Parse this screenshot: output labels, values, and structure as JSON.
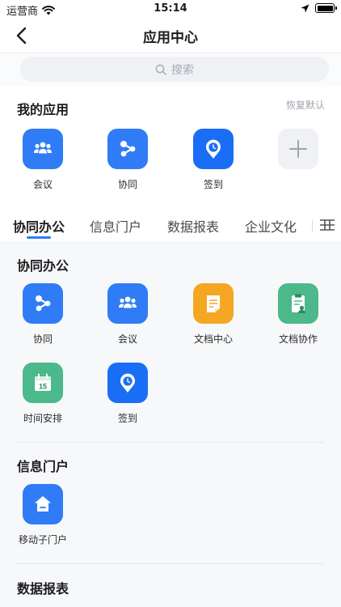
{
  "status_bar": {
    "carrier": "运营商",
    "time": "15:14"
  },
  "nav": {
    "title": "应用中心"
  },
  "search": {
    "placeholder": "搜索"
  },
  "my_apps": {
    "title": "我的应用",
    "restore_label": "恢复默认",
    "items": [
      {
        "label": "会议",
        "icon": "meeting-icon",
        "color": "#2f7cf6"
      },
      {
        "label": "协同",
        "icon": "collaboration-icon",
        "color": "#2f7cf6"
      },
      {
        "label": "签到",
        "icon": "location-clock-icon",
        "color": "#1a6ef5"
      }
    ]
  },
  "tabs": [
    {
      "label": "协同办公",
      "active": true
    },
    {
      "label": "信息门户",
      "active": false
    },
    {
      "label": "数据报表",
      "active": false
    },
    {
      "label": "企业文化",
      "active": false
    }
  ],
  "sections": [
    {
      "title": "协同办公",
      "items": [
        {
          "label": "协同",
          "icon": "collaboration-icon",
          "color": "#2f7cf6"
        },
        {
          "label": "会议",
          "icon": "meeting-icon",
          "color": "#2f7cf6"
        },
        {
          "label": "文档中心",
          "icon": "document-icon",
          "color": "#f5a623"
        },
        {
          "label": "文档协作",
          "icon": "document-edit-icon",
          "color": "#4bb98a"
        },
        {
          "label": "时间安排",
          "icon": "calendar-icon",
          "color": "#4bb98a"
        },
        {
          "label": "签到",
          "icon": "location-clock-icon",
          "color": "#1a6ef5"
        }
      ]
    },
    {
      "title": "信息门户",
      "items": [
        {
          "label": "移动子门户",
          "icon": "home-icon",
          "color": "#2f7cf6"
        }
      ]
    },
    {
      "title": "数据报表",
      "items": []
    }
  ],
  "calendar_day": "15"
}
